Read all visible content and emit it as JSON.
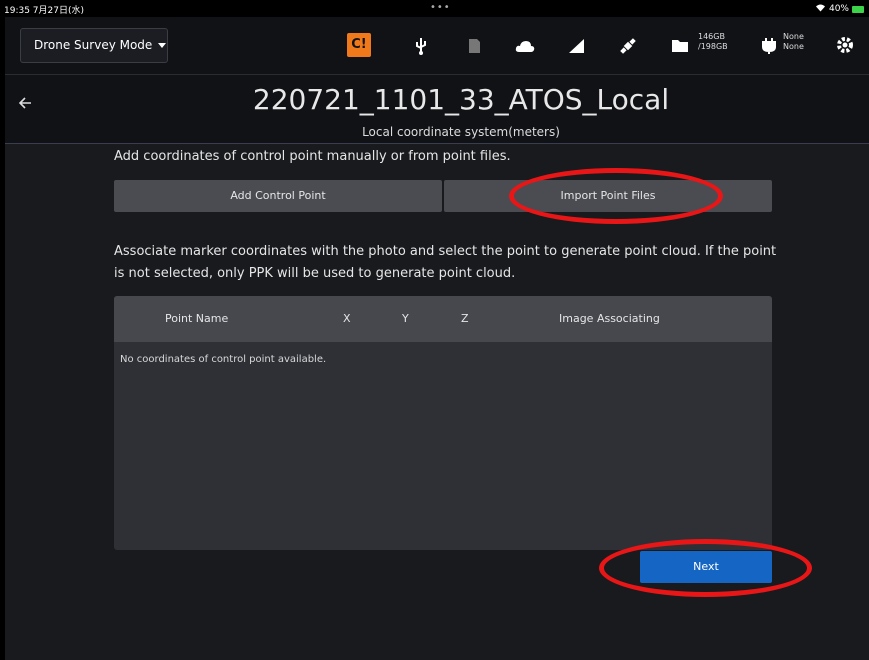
{
  "status_bar": {
    "time": "19:35 7月27日(水)",
    "dots": "•••",
    "battery": "40%"
  },
  "toolbar": {
    "mode_label": "Drone Survey Mode",
    "warning_glyph": "C!",
    "storage_used": "146GB",
    "storage_total": "/198GB",
    "power_line1": "None",
    "power_line2": "None"
  },
  "header": {
    "title": "220721_1101_33_ATOS_Local",
    "subtitle": "Local coordinate system(meters)"
  },
  "main": {
    "instruction_1": "Add coordinates of control point manually or from point files.",
    "add_button": "Add Control Point",
    "import_button": "Import Point Files",
    "instruction_2": "Associate marker coordinates with the photo and select the point to generate point cloud. If the point is not selected, only PPK will be used to generate point cloud.",
    "table": {
      "columns": [
        "Point Name",
        "X",
        "Y",
        "Z",
        "Image Associating"
      ],
      "empty_text": "No coordinates of control point available."
    },
    "next_button": "Next"
  },
  "colors": {
    "accent": "#1566c4",
    "warning": "#f07a1b",
    "highlight_ring": "#e81616"
  }
}
